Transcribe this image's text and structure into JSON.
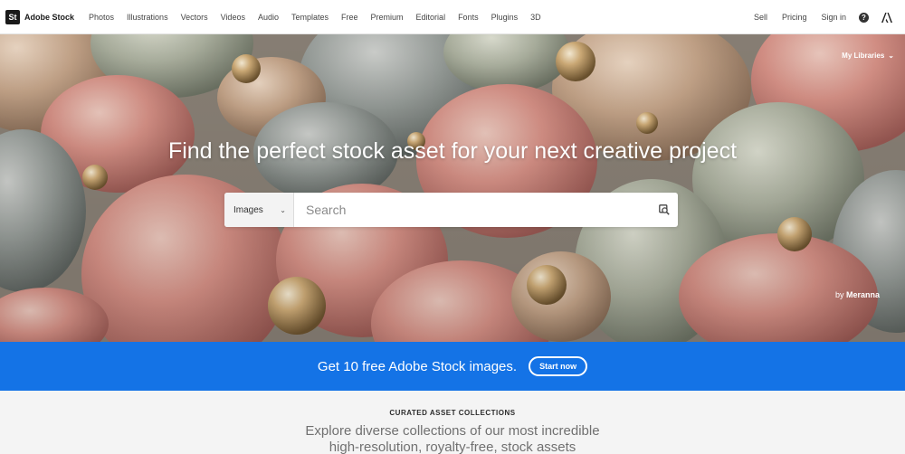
{
  "brand": {
    "logo_text": "St",
    "name": "Adobe Stock"
  },
  "nav": {
    "links": [
      "Photos",
      "Illustrations",
      "Vectors",
      "Videos",
      "Audio",
      "Templates",
      "Free",
      "Premium",
      "Editorial",
      "Fonts",
      "Plugins",
      "3D"
    ],
    "right_links": [
      "Sell",
      "Pricing",
      "Sign in"
    ],
    "help_icon": "help-circle-icon",
    "adobe_icon": "adobe-logo-icon"
  },
  "hero": {
    "libraries_label": "My Libraries",
    "title": "Find the perfect stock asset for your next creative project",
    "search": {
      "type_selected": "Images",
      "placeholder": "Search",
      "visual_search_icon": "visual-search-icon"
    },
    "credit_prefix": "by",
    "credit_author": "Meranna"
  },
  "promo": {
    "text": "Get 10 free Adobe Stock images.",
    "button_label": "Start now",
    "color": "#1473e6"
  },
  "collections": {
    "eyebrow": "CURATED ASSET COLLECTIONS",
    "line1": "Explore diverse collections of our most incredible",
    "line2": "high-resolution, royalty-free, stock assets"
  }
}
